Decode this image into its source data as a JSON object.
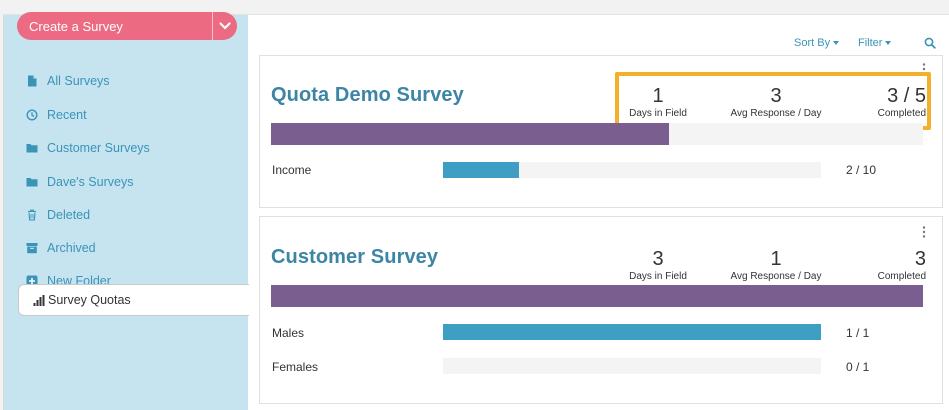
{
  "sidebar": {
    "create_button_label": "Create a Survey",
    "items": [
      {
        "label": "All Surveys",
        "icon": "file-icon"
      },
      {
        "label": "Recent",
        "icon": "clock-icon"
      },
      {
        "label": "Customer Surveys",
        "icon": "folder-icon"
      },
      {
        "label": "Dave's Surveys",
        "icon": "folder-icon"
      },
      {
        "label": "Deleted",
        "icon": "trash-icon"
      },
      {
        "label": "Archived",
        "icon": "archive-icon"
      },
      {
        "label": "New Folder",
        "icon": "plus-square-icon"
      }
    ],
    "active_item": {
      "label": "Survey Quotas",
      "icon": "bar-chart-icon"
    }
  },
  "toolbar": {
    "sort_label": "Sort By",
    "filter_label": "Filter"
  },
  "surveys": [
    {
      "title": "Quota Demo Survey",
      "stats": {
        "days_in_field": "1",
        "days_in_field_label": "Days in Field",
        "avg_response": "3",
        "avg_response_label": "Avg Response / Day",
        "completed": "3 / 5",
        "completed_label": "Completed"
      },
      "progress_fraction": 0.61,
      "quotas": [
        {
          "label": "Income",
          "count": "2 / 10",
          "fraction": 0.2
        }
      ]
    },
    {
      "title": "Customer Survey",
      "stats": {
        "days_in_field": "3",
        "days_in_field_label": "Days in Field",
        "avg_response": "1",
        "avg_response_label": "Avg Response / Day",
        "completed": "3",
        "completed_label": "Completed"
      },
      "progress_fraction": 1.0,
      "quotas": [
        {
          "label": "Males",
          "count": "1 / 1",
          "fraction": 1.0
        },
        {
          "label": "Females",
          "count": "0 / 1",
          "fraction": 0.0
        }
      ]
    }
  ],
  "colors": {
    "brand_pink": "#ec6a82",
    "sidebar_bg": "#c5e4f0",
    "link_blue": "#3b93b8",
    "progress_purple": "#7a5e8f",
    "quota_blue": "#3e9ec4",
    "highlight_orange": "#f3b12b"
  }
}
